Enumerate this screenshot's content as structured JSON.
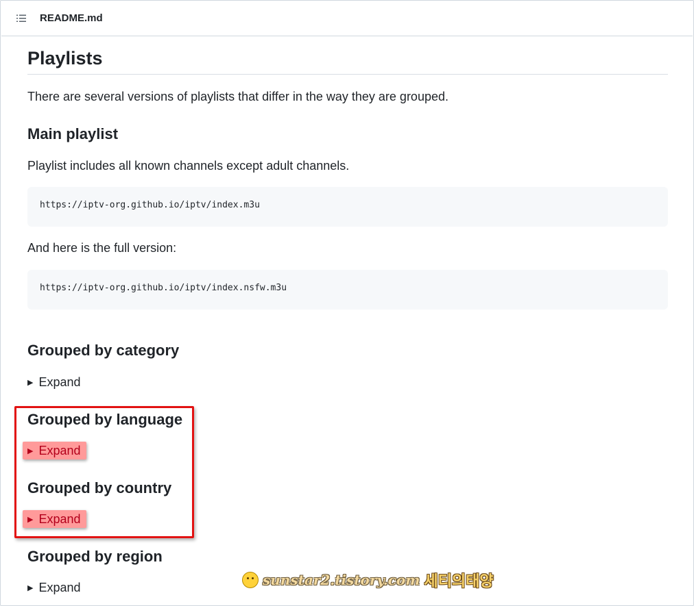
{
  "header": {
    "icon": "list-unordered-icon",
    "file_name": "README.md"
  },
  "article": {
    "title": "Playlists",
    "intro": "There are several versions of playlists that differ in the way they are grouped.",
    "main": {
      "heading": "Main playlist",
      "description": "Playlist includes all known channels except adult channels.",
      "url": "https://iptv-org.github.io/iptv/index.m3u",
      "full_text": "And here is the full version:",
      "full_url": "https://iptv-org.github.io/iptv/index.nsfw.m3u"
    },
    "sections": [
      {
        "heading": "Grouped by category",
        "expand_label": "Expand"
      },
      {
        "heading": "Grouped by language",
        "expand_label": "Expand"
      },
      {
        "heading": "Grouped by country",
        "expand_label": "Expand"
      },
      {
        "heading": "Grouped by region",
        "expand_label": "Expand"
      }
    ],
    "toggle_icon": "triangle-right-icon"
  },
  "watermark": {
    "site": "sunstar2.tistory.com",
    "korean": "세티의태양"
  },
  "colors": {
    "highlight_box": "#e21212",
    "highlight_fill": "#ff9a9a"
  }
}
